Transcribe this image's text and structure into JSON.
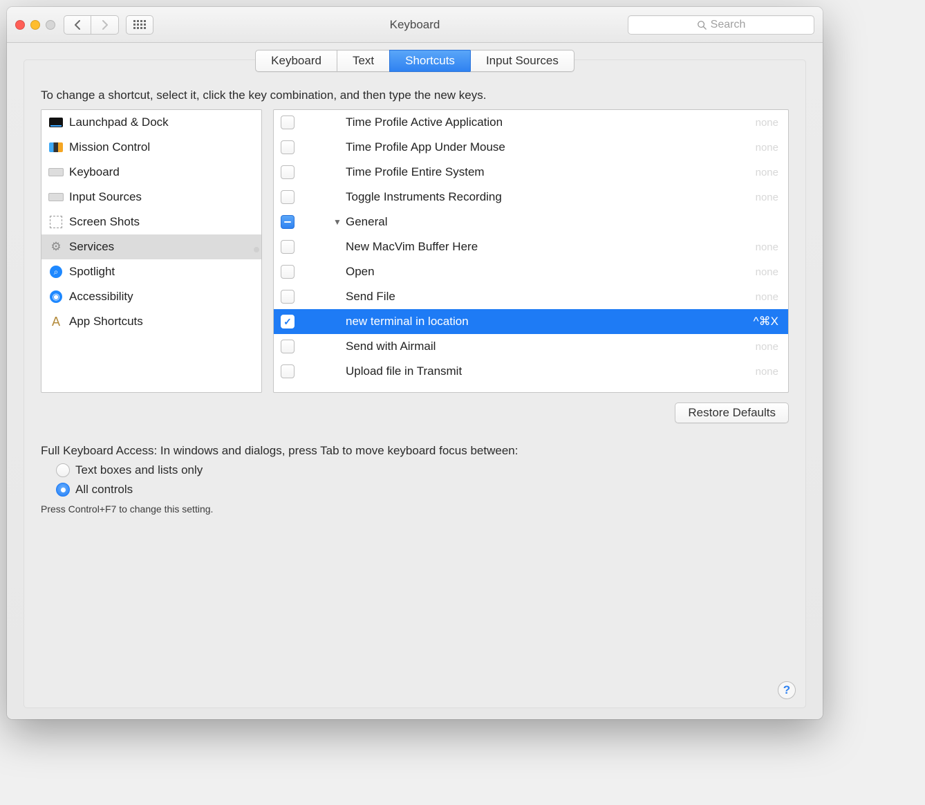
{
  "window": {
    "title": "Keyboard"
  },
  "search": {
    "placeholder": "Search"
  },
  "tabs": {
    "items": [
      "Keyboard",
      "Text",
      "Shortcuts",
      "Input Sources"
    ],
    "active_index": 2
  },
  "instruction": "To change a shortcut, select it, click the key combination, and then type the new keys.",
  "categories": {
    "items": [
      {
        "label": "Launchpad & Dock",
        "icon": "launchpad"
      },
      {
        "label": "Mission Control",
        "icon": "mission-control"
      },
      {
        "label": "Keyboard",
        "icon": "keyboard"
      },
      {
        "label": "Input Sources",
        "icon": "keyboard"
      },
      {
        "label": "Screen Shots",
        "icon": "screenshot"
      },
      {
        "label": "Services",
        "icon": "gear"
      },
      {
        "label": "Spotlight",
        "icon": "spotlight"
      },
      {
        "label": "Accessibility",
        "icon": "accessibility"
      },
      {
        "label": "App Shortcuts",
        "icon": "app"
      }
    ],
    "selected_index": 5
  },
  "services": {
    "rows": [
      {
        "kind": "item",
        "checked": false,
        "label": "Time Profile Active Application",
        "shortcut": "none"
      },
      {
        "kind": "item",
        "checked": false,
        "label": "Time Profile App Under Mouse",
        "shortcut": "none"
      },
      {
        "kind": "item",
        "checked": false,
        "label": "Time Profile Entire System",
        "shortcut": "none"
      },
      {
        "kind": "item",
        "checked": false,
        "label": "Toggle Instruments Recording",
        "shortcut": "none"
      },
      {
        "kind": "group",
        "checked": "indeterminate",
        "label": "General",
        "expanded": true
      },
      {
        "kind": "item",
        "checked": false,
        "label": "New MacVim Buffer Here",
        "shortcut": "none"
      },
      {
        "kind": "item",
        "checked": false,
        "label": "Open",
        "shortcut": "none"
      },
      {
        "kind": "item",
        "checked": false,
        "label": "Send File",
        "shortcut": "none"
      },
      {
        "kind": "item",
        "checked": true,
        "label": "new terminal in location",
        "shortcut": "^⌘X",
        "selected": true
      },
      {
        "kind": "item",
        "checked": false,
        "label": "Send with Airmail",
        "shortcut": "none"
      },
      {
        "kind": "item",
        "checked": false,
        "label": "Upload file in Transmit",
        "shortcut": "none"
      }
    ]
  },
  "restore_button": "Restore Defaults",
  "fka": {
    "heading": "Full Keyboard Access: In windows and dialogs, press Tab to move keyboard focus between:",
    "option_text_only": "Text boxes and lists only",
    "option_all": "All controls",
    "selected": "all",
    "hint": "Press Control+F7 to change this setting."
  },
  "help_label": "?"
}
